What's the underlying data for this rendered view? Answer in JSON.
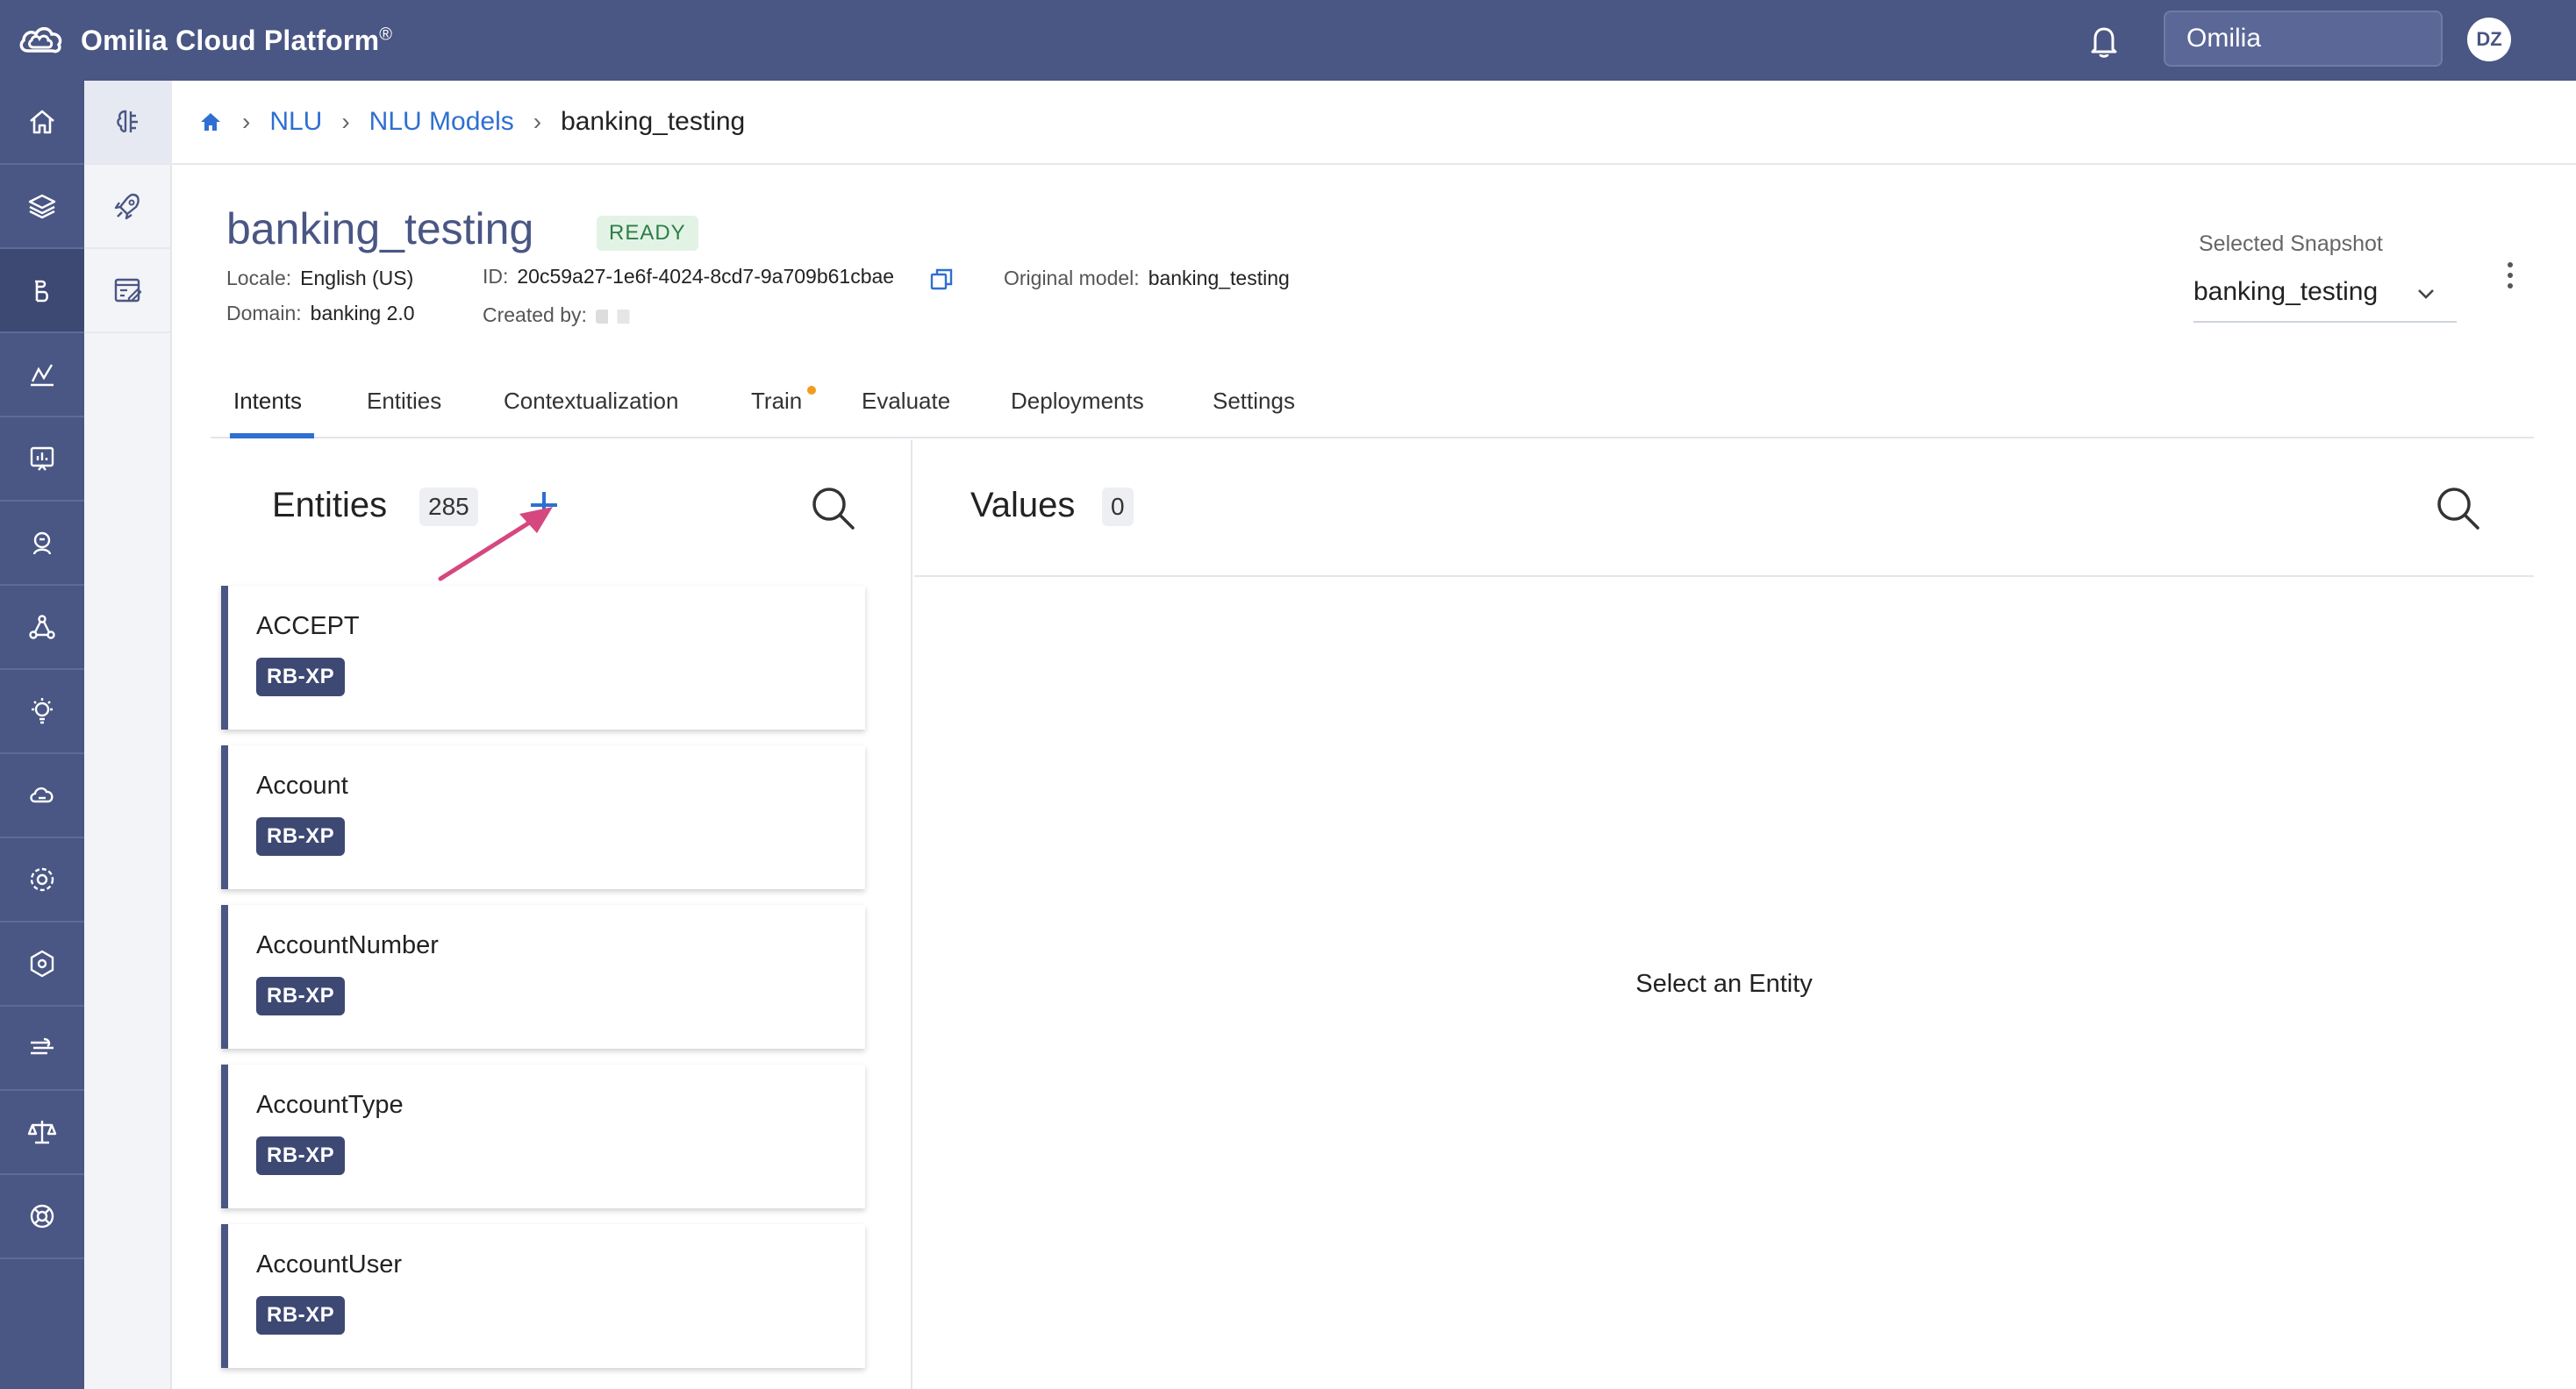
{
  "topbar": {
    "app_name": "Omilia Cloud Platform",
    "app_mark": "®",
    "org_selector": "Omilia",
    "avatar_initials": "DZ",
    "brand_color": "#4a5683"
  },
  "breadcrumb": {
    "items": [
      "NLU",
      "NLU Models"
    ],
    "current": "banking_testing"
  },
  "model": {
    "title": "banking_testing",
    "status": "READY",
    "locale_label": "Locale:",
    "locale_value": "English (US)",
    "domain_label": "Domain:",
    "domain_value": "banking 2.0",
    "id_label": "ID:",
    "id_value": "20c59a27-1e6f-4024-8cd7-9a709b61cbae",
    "created_label": "Created by:",
    "original_label": "Original model:",
    "original_value": "banking_testing"
  },
  "snapshot": {
    "label": "Selected Snapshot",
    "value": "banking_testing"
  },
  "tabs": [
    {
      "label": "Intents"
    },
    {
      "label": "Entities"
    },
    {
      "label": "Contextualization"
    },
    {
      "label": "Train"
    },
    {
      "label": "Evaluate"
    },
    {
      "label": "Deployments"
    },
    {
      "label": "Settings"
    }
  ],
  "entities_panel": {
    "title": "Entities",
    "count": "285",
    "items": [
      {
        "name": "ACCEPT",
        "tag": "RB-XP"
      },
      {
        "name": "Account",
        "tag": "RB-XP"
      },
      {
        "name": "AccountNumber",
        "tag": "RB-XP"
      },
      {
        "name": "AccountType",
        "tag": "RB-XP"
      },
      {
        "name": "AccountUser",
        "tag": "RB-XP"
      }
    ]
  },
  "values_panel": {
    "title": "Values",
    "count": "0",
    "empty_message": "Select an Entity"
  },
  "icons": {
    "rail": [
      "home-icon",
      "layers-icon",
      "nlu-icon",
      "analytics-icon",
      "reports-icon",
      "agent-icon",
      "network-icon",
      "insights-icon",
      "cloud-icon",
      "settings-icon",
      "admin-icon",
      "speech-icon",
      "balance-icon",
      "support-icon"
    ]
  },
  "accent_color": "#2f6fd1",
  "arrow_color": "#d6477f"
}
